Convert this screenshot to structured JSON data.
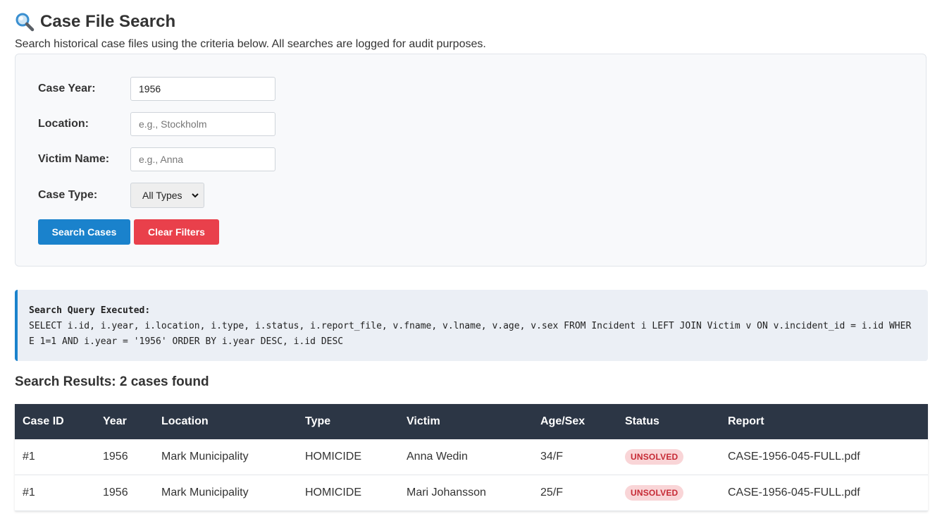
{
  "header": {
    "title": "Case File Search",
    "subtitle": "Search historical case files using the criteria below. All searches are logged for audit purposes."
  },
  "form": {
    "case_year": {
      "label": "Case Year:",
      "value": "1956",
      "placeholder": ""
    },
    "location": {
      "label": "Location:",
      "value": "",
      "placeholder": "e.g., Stockholm"
    },
    "victim_name": {
      "label": "Victim Name:",
      "value": "",
      "placeholder": "e.g., Anna"
    },
    "case_type": {
      "label": "Case Type:",
      "selected": "All Types"
    },
    "search_button": "Search Cases",
    "clear_button": "Clear Filters"
  },
  "query": {
    "label": "Search Query Executed:",
    "sql": "SELECT i.id, i.year, i.location, i.type, i.status, i.report_file, v.fname, v.lname, v.age, v.sex FROM Incident i LEFT JOIN Victim v ON v.incident_id = i.id WHERE 1=1 AND i.year = '1956' ORDER BY i.year DESC, i.id DESC"
  },
  "results": {
    "heading": "Search Results: 2 cases found",
    "columns": [
      "Case ID",
      "Year",
      "Location",
      "Type",
      "Victim",
      "Age/Sex",
      "Status",
      "Report"
    ],
    "rows": [
      {
        "case_id": "#1",
        "year": "1956",
        "location": "Mark Municipality",
        "type": "HOMICIDE",
        "victim": "Anna Wedin",
        "age_sex": "34/F",
        "status": "UNSOLVED",
        "report": "CASE-1956-045-FULL.pdf"
      },
      {
        "case_id": "#1",
        "year": "1956",
        "location": "Mark Municipality",
        "type": "HOMICIDE",
        "victim": "Mari Johansson",
        "age_sex": "25/F",
        "status": "UNSOLVED",
        "report": "CASE-1956-045-FULL.pdf"
      }
    ]
  },
  "icons": {
    "title_icon": "magnifier-icon",
    "select_icon": "chevron-down-icon"
  },
  "colors": {
    "primary": "#1a82cc",
    "danger": "#e9404b",
    "table_header": "#2c3645",
    "status_badge_bg": "#f9d5d7",
    "status_badge_text": "#c62a35"
  }
}
